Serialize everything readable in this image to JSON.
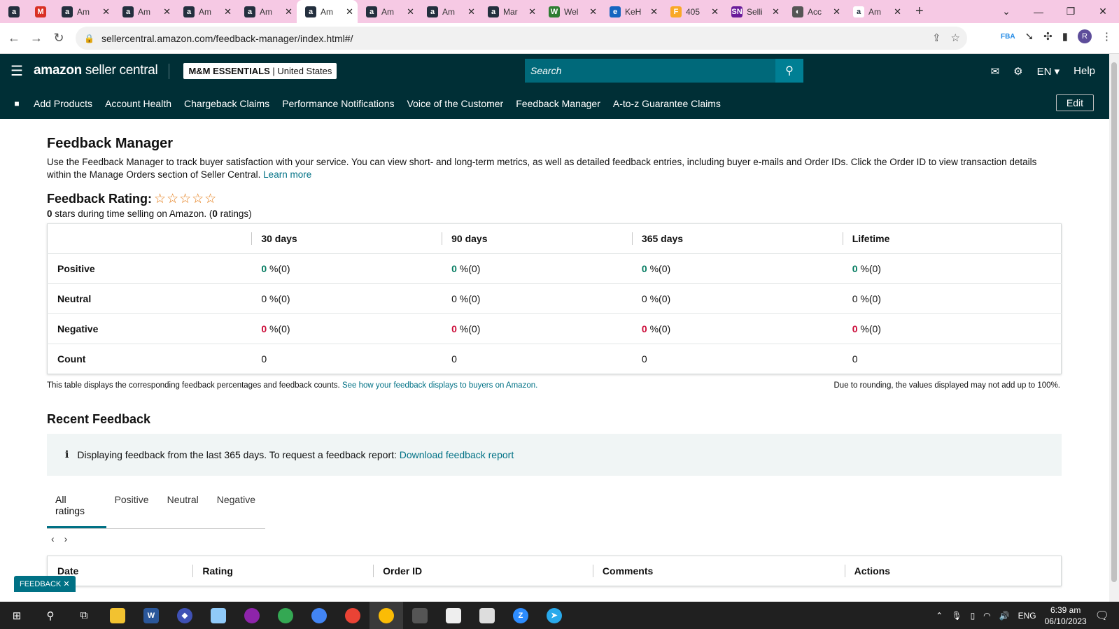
{
  "browser": {
    "tabs": [
      {
        "label": "",
        "icon": "a",
        "color": "#232f3e"
      },
      {
        "label": "",
        "icon": "M",
        "color": "#d93025"
      },
      {
        "label": "Am",
        "icon": "a",
        "color": "#232f3e"
      },
      {
        "label": "Am",
        "icon": "a",
        "color": "#232f3e"
      },
      {
        "label": "Am",
        "icon": "a",
        "color": "#232f3e"
      },
      {
        "label": "Am",
        "icon": "a",
        "color": "#232f3e"
      },
      {
        "label": "Am",
        "icon": "a",
        "color": "#232f3e",
        "active": true
      },
      {
        "label": "Am",
        "icon": "a",
        "color": "#232f3e"
      },
      {
        "label": "Am",
        "icon": "a",
        "color": "#232f3e"
      },
      {
        "label": "Mar",
        "icon": "a",
        "color": "#232f3e"
      },
      {
        "label": "Wel",
        "icon": "W",
        "color": "#2e7d32"
      },
      {
        "label": "KeH",
        "icon": "e",
        "color": "#1565c0"
      },
      {
        "label": "405",
        "icon": "F",
        "color": "#f9a825"
      },
      {
        "label": "Selli",
        "icon": "SN",
        "color": "#6a1b9a"
      },
      {
        "label": "Acc",
        "icon": "◐",
        "color": "#555555"
      },
      {
        "label": "Am",
        "icon": "a",
        "color": "#ffffff"
      }
    ],
    "url": "sellercentral.amazon.com/feedback-manager/index.html#/"
  },
  "header": {
    "logo_bold": "amazon",
    "logo_rest": " seller central",
    "store_name": "M&M ESSENTIALS",
    "store_region": " | United States",
    "search_placeholder": "Search",
    "lang": "EN ▾",
    "help": "Help"
  },
  "nav": {
    "items": [
      "Add Products",
      "Account Health",
      "Chargeback Claims",
      "Performance Notifications",
      "Voice of the Customer",
      "Feedback Manager",
      "A-to-z Guarantee Claims"
    ],
    "edit": "Edit"
  },
  "page": {
    "title": "Feedback Manager",
    "intro": "Use the Feedback Manager to track buyer satisfaction with your service. You can view short- and long-term metrics, as well as detailed feedback entries, including buyer e-mails and Order IDs. Click the Order ID to view transaction details within the Manage Orders section of Seller Central.",
    "learn_more": "Learn more",
    "rating_label": "Feedback Rating:",
    "stars": "☆☆☆☆☆",
    "stars_count": "0",
    "stars_text": " stars during time selling on Amazon. (",
    "ratings_count": "0",
    "ratings_text": " ratings)",
    "table": {
      "columns": [
        "30 days",
        "90 days",
        "365 days",
        "Lifetime"
      ],
      "rows": [
        {
          "label": "Positive",
          "type": "pos",
          "values": [
            "0",
            "0",
            "0",
            "0"
          ],
          "suffix": " %(0)"
        },
        {
          "label": "Neutral",
          "type": "neu",
          "values": [
            "0",
            "0",
            "0",
            "0"
          ],
          "suffix": " %(0)"
        },
        {
          "label": "Negative",
          "type": "neg",
          "values": [
            "0",
            "0",
            "0",
            "0"
          ],
          "suffix": " %(0)"
        },
        {
          "label": "Count",
          "type": "cnt",
          "values": [
            "0",
            "0",
            "0",
            "0"
          ],
          "suffix": ""
        }
      ]
    },
    "note_left": "This table displays the corresponding feedback percentages and feedback counts.",
    "note_link": "See how your feedback displays to buyers on Amazon.",
    "note_right": "Due to rounding, the values displayed may not add up to 100%.",
    "recent_title": "Recent Feedback",
    "info_text": "Displaying feedback from the last 365 days. To request a feedback report:",
    "info_link": "Download feedback report",
    "filter_tabs": [
      "All ratings",
      "Positive",
      "Neutral",
      "Negative"
    ],
    "recent_columns": [
      "Date",
      "Rating",
      "Order ID",
      "Comments",
      "Actions"
    ],
    "feedback_tab": "FEEDBACK ✕"
  },
  "taskbar": {
    "lang": "ENG",
    "time": "6:39 am",
    "date": "06/10/2023"
  }
}
